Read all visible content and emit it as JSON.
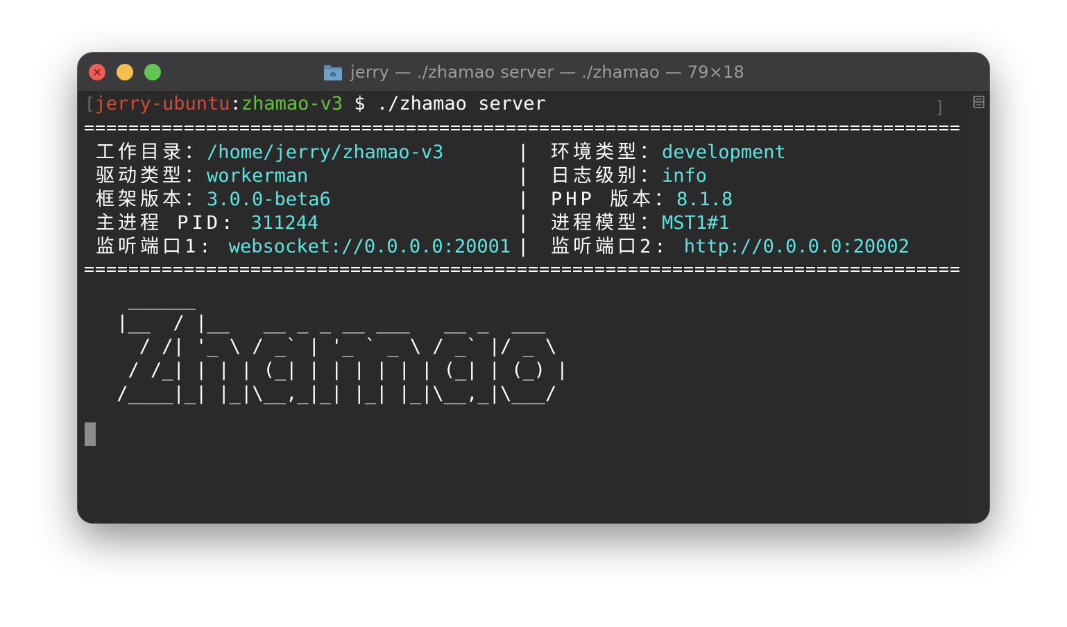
{
  "window": {
    "title": "jerry — ./zhamao server — ./zhamao — 79×18",
    "icons": {
      "close": "close-icon",
      "minimize": "minimize-icon",
      "zoom": "zoom-icon",
      "folder": "folder-icon",
      "split": "split-pane-icon"
    }
  },
  "colors": {
    "host": "#ce4c3a",
    "path": "#64c13c",
    "value": "#5de3e0",
    "background": "#2a2a2a"
  },
  "prompt": {
    "open_bracket": "[",
    "close_bracket": "]",
    "host": "jerry-ubuntu",
    "colon": ":",
    "cwd": "zhamao-v3",
    "symbol": " $ ",
    "command": "./zhamao server"
  },
  "info": {
    "rows": [
      {
        "left_key": "工作目录：",
        "left_value": "/home/jerry/zhamao-v3",
        "right_key": "环境类型：",
        "right_value": "development"
      },
      {
        "left_key": "驱动类型：",
        "left_value": "workerman",
        "right_key": "日志级别：",
        "right_value": "info"
      },
      {
        "left_key": "框架版本：",
        "left_value": "3.0.0-beta6",
        "right_key": "PHP 版本：",
        "right_value": "8.1.8"
      },
      {
        "left_key": "主进程 PID: ",
        "left_value": "311244",
        "right_key": "进程模型：",
        "right_value": "MST1#1"
      },
      {
        "left_key": "监听端口1: ",
        "left_value": "websocket://0.0.0.0:20001",
        "right_key": "监听端口2: ",
        "right_value": "http://0.0.0.0:20002"
      }
    ],
    "divider": "|"
  },
  "banner": {
    "lines": [
      "  ______",
      " |__  / |__   __ _ _ __ ___   __ _  ___",
      "   / /| '_ \\ / _` | '_ ` _ \\ / _` |/ _ \\",
      "  / /_| | | | (_| | | | | | | (_| | (_) |",
      " /____|_| |_|\\__,_|_| |_| |_|\\__,_|\\___/"
    ]
  }
}
